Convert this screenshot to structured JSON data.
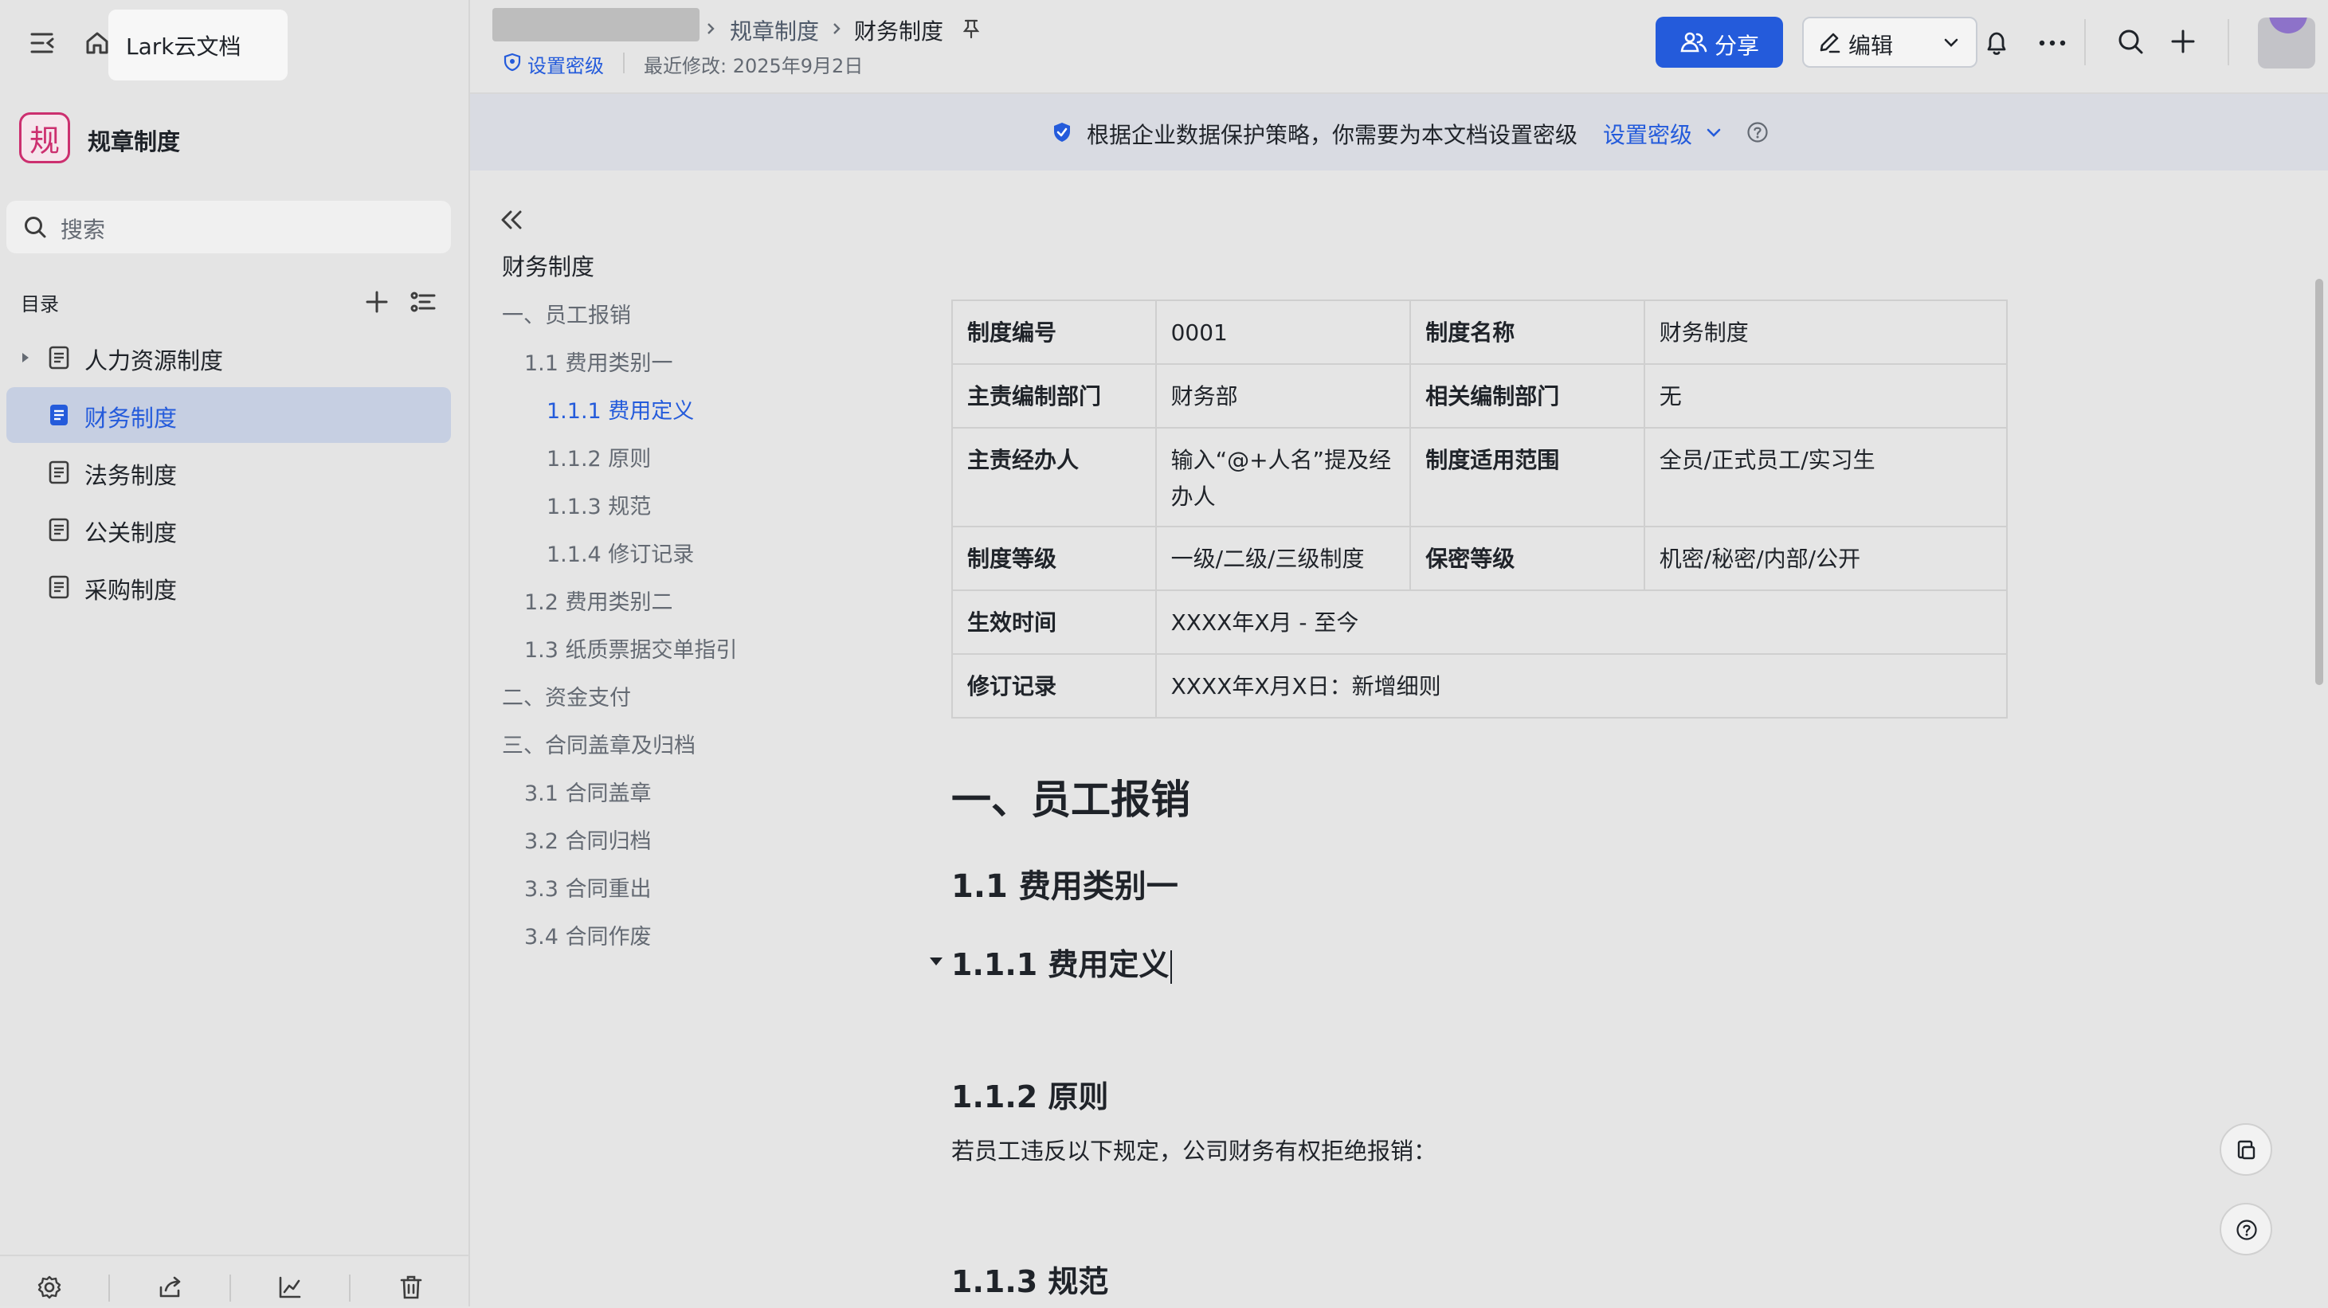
{
  "sidebar": {
    "home_tooltip": "Lark云文档",
    "space_logo_char": "规",
    "space_name": "规章制度",
    "search_placeholder": "搜索",
    "toc_label": "目录",
    "items": [
      {
        "label": "人力资源制度",
        "expandable": true,
        "active": false
      },
      {
        "label": "财务制度",
        "expandable": false,
        "active": true
      },
      {
        "label": "法务制度",
        "expandable": false,
        "active": false
      },
      {
        "label": "公关制度",
        "expandable": false,
        "active": false
      },
      {
        "label": "采购制度",
        "expandable": false,
        "active": false
      }
    ]
  },
  "header": {
    "breadcrumb": [
      "规章制度",
      "财务制度"
    ],
    "security_link": "设置密级",
    "last_modified": "最近修改: 2025年9月2日",
    "share_label": "分享",
    "edit_label": "编辑"
  },
  "banner": {
    "text": "根据企业数据保护策略，你需要为本文档设置密级",
    "action": "设置密级"
  },
  "outline": {
    "root": "财务制度",
    "items": [
      {
        "label": "一、员工报销",
        "level": 1
      },
      {
        "label": "1.1 费用类别一",
        "level": 2
      },
      {
        "label": "1.1.1 费用定义",
        "level": 3,
        "active": true
      },
      {
        "label": "1.1.2 原则",
        "level": 3
      },
      {
        "label": "1.1.3 规范",
        "level": 3
      },
      {
        "label": "1.1.4 修订记录",
        "level": 3
      },
      {
        "label": "1.2 费用类别二",
        "level": 2
      },
      {
        "label": "1.3 纸质票据交单指引",
        "level": 2
      },
      {
        "label": "二、资金支付",
        "level": 1
      },
      {
        "label": "三、合同盖章及归档",
        "level": 1
      },
      {
        "label": "3.1 合同盖章",
        "level": 2
      },
      {
        "label": "3.2 合同归档",
        "level": 2
      },
      {
        "label": "3.3 合同重出",
        "level": 2
      },
      {
        "label": "3.4 合同作废",
        "level": 2
      }
    ]
  },
  "doc": {
    "table": {
      "r1": [
        "制度编号",
        "0001",
        "制度名称",
        "财务制度"
      ],
      "r2": [
        "主责编制部门",
        "财务部",
        "相关编制部门",
        "无"
      ],
      "r3": [
        "主责经办人",
        "输入“@+人名”提及经办人",
        "制度适用范围",
        "全员/正式员工/实习生"
      ],
      "r4": [
        "制度等级",
        "一级/二级/三级制度",
        "保密等级",
        "机密/秘密/内部/公开"
      ],
      "r5": [
        "生效时间",
        "XXXX年X月 - 至今"
      ],
      "r6": [
        "修订记录",
        "XXXX年X月X日：新增细则"
      ]
    },
    "h1": "一、员工报销",
    "h2": "1.1 费用类别一",
    "h3a": "1.1.1 费用定义",
    "h3b": "1.1.2 原则",
    "para": "若员工违反以下规定，公司财务有权拒绝报销：",
    "h3c": "1.1.3 规范"
  }
}
